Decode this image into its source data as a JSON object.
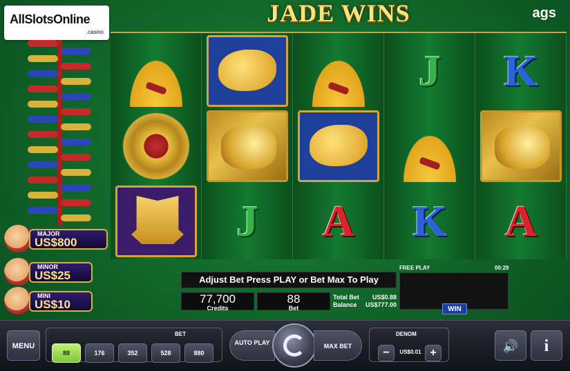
{
  "watermark": {
    "text": "AllSlotsOnline",
    "suffix": ".casino"
  },
  "game": {
    "title": "JADE WINS",
    "brand": "ags"
  },
  "jackpots": [
    {
      "label": "MAJOR",
      "value": "US$800"
    },
    {
      "label": "MINOR",
      "value": "US$25"
    },
    {
      "label": "MINI",
      "value": "US$10"
    }
  ],
  "reels": [
    [
      "fan-icon",
      "medal-icon",
      "ship-icon"
    ],
    [
      "fish-icon",
      "tiger-icon",
      "J"
    ],
    [
      "fan-icon",
      "fish-icon",
      "A"
    ],
    [
      "J",
      "fan-icon",
      "K"
    ],
    [
      "K",
      "tiger-icon",
      "A"
    ]
  ],
  "message": "Adjust Bet Press PLAY or Bet Max To Play",
  "free_play": {
    "label": "FREE PLAY",
    "time": "00:29"
  },
  "meters": {
    "credits_value": "77,700",
    "credits_label": "Credits",
    "bet_value": "88",
    "bet_label": "Bet"
  },
  "totals": {
    "total_bet_label": "Total Bet",
    "total_bet_value": "US$0.88",
    "balance_label": "Balance",
    "balance_value": "US$777.00"
  },
  "win_label": "WIN",
  "controls": {
    "menu": "MENU",
    "bet_label": "BET",
    "bet_options": [
      "88",
      "176",
      "352",
      "528",
      "880"
    ],
    "selected_bet": "88",
    "auto_play": "AUTO PLAY",
    "max_bet": "MAX BET",
    "denom_label": "DENOM",
    "denom_value": "US$0.01",
    "minus": "−",
    "plus": "+",
    "info": "i"
  },
  "colors": {
    "felt": "#137a30",
    "gold": "#d6a53a",
    "jackpot_text": "#ffe08a",
    "selected_bet": "#7fc63a"
  }
}
